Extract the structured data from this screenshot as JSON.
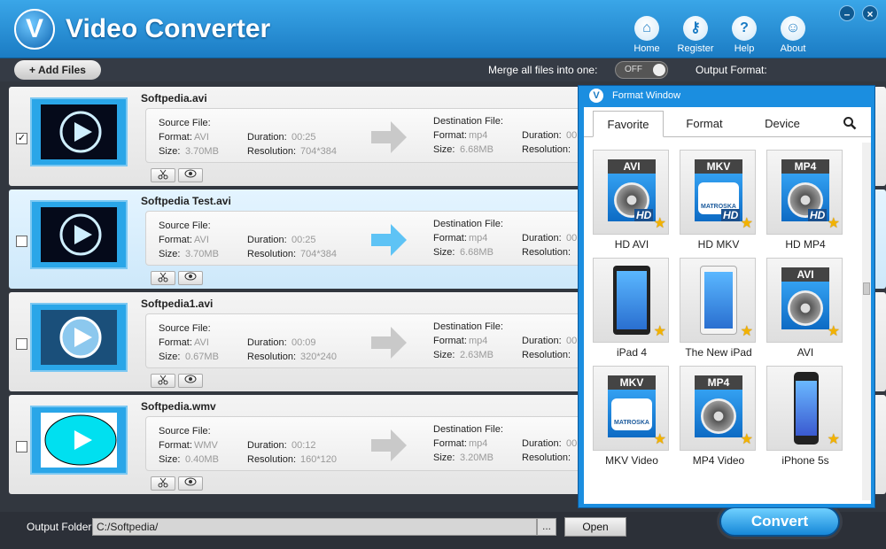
{
  "app": {
    "title": "Video Converter",
    "logo_letter": "V"
  },
  "nav": [
    {
      "label": "Home",
      "icon": "home-icon",
      "glyph": "⌂"
    },
    {
      "label": "Register",
      "icon": "key-icon",
      "glyph": "⚷"
    },
    {
      "label": "Help",
      "icon": "help-icon",
      "glyph": "?"
    },
    {
      "label": "About",
      "icon": "about-icon",
      "glyph": "☺"
    }
  ],
  "window_controls": {
    "minimize": "–",
    "close": "×"
  },
  "toolbar": {
    "add_files": "+ Add Files",
    "merge_label": "Merge all files into one:",
    "merge_state": "OFF",
    "output_format_label": "Output Format:"
  },
  "labels": {
    "source_file": "Source File:",
    "format": "Format:",
    "duration": "Duration:",
    "size": "Size:",
    "resolution": "Resolution:",
    "destination_file": "Destination File:"
  },
  "files": [
    {
      "name": "Softpedia.avi",
      "checked": "✓",
      "src_format": "AVI",
      "src_duration": "00:25",
      "src_size": "3.70MB",
      "src_resolution": "704*384",
      "dst_format": "mp4",
      "dst_size": "6.68MB",
      "dst_duration": "00"
    },
    {
      "name": "Softpedia Test.avi",
      "checked": "",
      "src_format": "AVI",
      "src_duration": "00:25",
      "src_size": "3.70MB",
      "src_resolution": "704*384",
      "dst_format": "mp4",
      "dst_size": "6.68MB",
      "dst_duration": "00"
    },
    {
      "name": "Softpedia1.avi",
      "checked": "",
      "src_format": "AVI",
      "src_duration": "00:09",
      "src_size": "0.67MB",
      "src_resolution": "320*240",
      "dst_format": "mp4",
      "dst_size": "2.63MB",
      "dst_duration": "00"
    },
    {
      "name": "Softpedia.wmv",
      "checked": "",
      "src_format": "WMV",
      "src_duration": "00:12",
      "src_size": "0.40MB",
      "src_resolution": "160*120",
      "dst_format": "mp4",
      "dst_size": "3.20MB",
      "dst_duration": "00"
    }
  ],
  "footer": {
    "output_folder_label": "Output Folder:",
    "output_folder_value": "C:/Softpedia/",
    "browse": "...",
    "open": "Open",
    "convert": "Convert"
  },
  "format_window": {
    "title": "Format Window",
    "tabs": [
      "Favorite",
      "Format",
      "Device"
    ],
    "tiles": [
      {
        "label": "HD AVI",
        "badge": "AVI",
        "kind": "reel",
        "hd": "HD"
      },
      {
        "label": "HD MKV",
        "badge": "MKV",
        "kind": "mkv",
        "hd": "HD"
      },
      {
        "label": "HD MP4",
        "badge": "MP4",
        "kind": "reel",
        "hd": "HD"
      },
      {
        "label": "iPad 4",
        "badge": "",
        "kind": "ipad-black",
        "hd": ""
      },
      {
        "label": "The New iPad",
        "badge": "",
        "kind": "ipad-white",
        "hd": ""
      },
      {
        "label": "AVI",
        "badge": "AVI",
        "kind": "reel",
        "hd": ""
      },
      {
        "label": "MKV Video",
        "badge": "MKV",
        "kind": "mkv",
        "hd": ""
      },
      {
        "label": "MP4 Video",
        "badge": "MP4",
        "kind": "reel",
        "hd": ""
      },
      {
        "label": "iPhone 5s",
        "badge": "",
        "kind": "iphone",
        "hd": ""
      }
    ],
    "matroska": "MATROSKA"
  }
}
